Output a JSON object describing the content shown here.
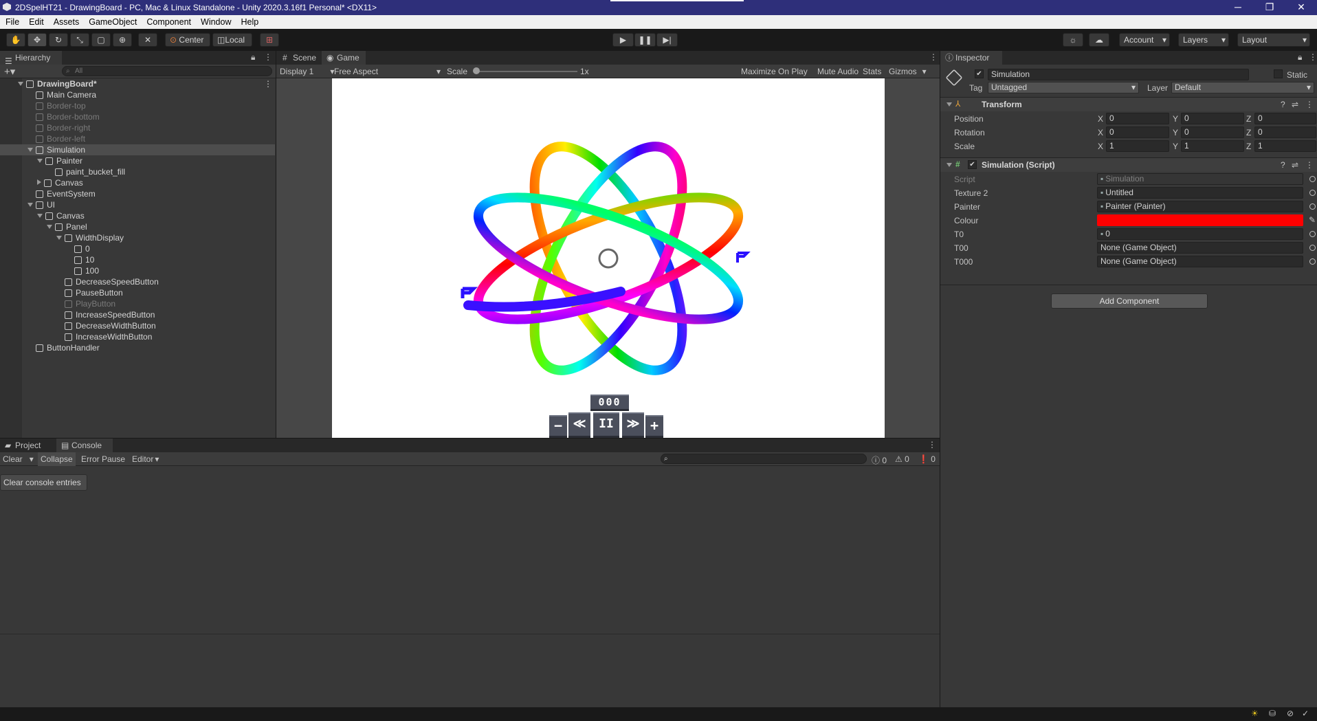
{
  "window": {
    "title": "2DSpelHT21 - DrawingBoard - PC, Mac & Linux Standalone - Unity 2020.3.16f1 Personal* <DX11>",
    "minimize": "─",
    "restore": "❐",
    "close": "✕"
  },
  "menu": [
    "File",
    "Edit",
    "Assets",
    "GameObject",
    "Component",
    "Window",
    "Help"
  ],
  "toolbar": {
    "pivot": "Center",
    "space": "Local",
    "account": "Account",
    "layers": "Layers",
    "layout": "Layout",
    "play_icon": "play-icon",
    "pause_icon": "pause-icon",
    "step_icon": "step-icon"
  },
  "hierarchy": {
    "tab": "Hierarchy",
    "search_placeholder": "All",
    "items": [
      {
        "label": "DrawingBoard*",
        "depth": 0,
        "expanded": true,
        "scene": true
      },
      {
        "label": "Main Camera",
        "depth": 1
      },
      {
        "label": "Border-top",
        "depth": 1,
        "dim": true
      },
      {
        "label": "Border-bottom",
        "depth": 1,
        "dim": true
      },
      {
        "label": "Border-right",
        "depth": 1,
        "dim": true
      },
      {
        "label": "Border-left",
        "depth": 1,
        "dim": true
      },
      {
        "label": "Simulation",
        "depth": 1,
        "expanded": true,
        "selected": true
      },
      {
        "label": "Painter",
        "depth": 2,
        "expanded": true
      },
      {
        "label": "paint_bucket_fill",
        "depth": 3
      },
      {
        "label": "Canvas",
        "depth": 2,
        "collapsed": true
      },
      {
        "label": "EventSystem",
        "depth": 1
      },
      {
        "label": "UI",
        "depth": 1,
        "expanded": true
      },
      {
        "label": "Canvas",
        "depth": 2,
        "expanded": true
      },
      {
        "label": "Panel",
        "depth": 3,
        "expanded": true
      },
      {
        "label": "WidthDisplay",
        "depth": 4,
        "expanded": true
      },
      {
        "label": "0",
        "depth": 5
      },
      {
        "label": "10",
        "depth": 5
      },
      {
        "label": "100",
        "depth": 5
      },
      {
        "label": "DecreaseSpeedButton",
        "depth": 4
      },
      {
        "label": "PauseButton",
        "depth": 4
      },
      {
        "label": "PlayButton",
        "depth": 4,
        "dim": true
      },
      {
        "label": "IncreaseSpeedButton",
        "depth": 4
      },
      {
        "label": "DecreaseWidthButton",
        "depth": 4
      },
      {
        "label": "IncreaseWidthButton",
        "depth": 4
      },
      {
        "label": "ButtonHandler",
        "depth": 1
      }
    ]
  },
  "game_view": {
    "tabs": [
      "Scene",
      "Game"
    ],
    "display": "Display 1",
    "aspect": "Free Aspect",
    "scale_label": "Scale",
    "scale_value": "1x",
    "maximize": "Maximize On Play",
    "mute": "Mute Audio",
    "stats": "Stats",
    "gizmos": "Gizmos",
    "width_display": "000",
    "buttons": [
      "−",
      "≪",
      "II",
      "≫",
      "+"
    ]
  },
  "inspector": {
    "tab": "Inspector",
    "object_name": "Simulation",
    "static_label": "Static",
    "tag_label": "Tag",
    "tag_value": "Untagged",
    "layer_label": "Layer",
    "layer_value": "Default",
    "transform": {
      "title": "Transform",
      "rows": [
        {
          "label": "Position",
          "x": "0",
          "y": "0",
          "z": "0"
        },
        {
          "label": "Rotation",
          "x": "0",
          "y": "0",
          "z": "0"
        },
        {
          "label": "Scale",
          "x": "1",
          "y": "1",
          "z": "1"
        }
      ]
    },
    "script": {
      "title": "Simulation (Script)",
      "fields": [
        {
          "label": "Script",
          "value": "Simulation",
          "dim": true
        },
        {
          "label": "Texture 2",
          "value": "Untitled"
        },
        {
          "label": "Painter",
          "value": "Painter (Painter)"
        },
        {
          "label": "Colour",
          "value": "",
          "color": "#ff0000"
        },
        {
          "label": "T0",
          "value": "0"
        },
        {
          "label": "T00",
          "value": "None (Game Object)"
        },
        {
          "label": "T000",
          "value": "None (Game Object)"
        }
      ]
    },
    "add_component": "Add Component"
  },
  "console": {
    "tabs": [
      "Project",
      "Console"
    ],
    "clear": "Clear",
    "collapse": "Collapse",
    "error_pause": "Error Pause",
    "editor": "Editor",
    "log_count": "0",
    "warn_count": "0",
    "error_count": "0",
    "clear_entries": "Clear console entries"
  }
}
